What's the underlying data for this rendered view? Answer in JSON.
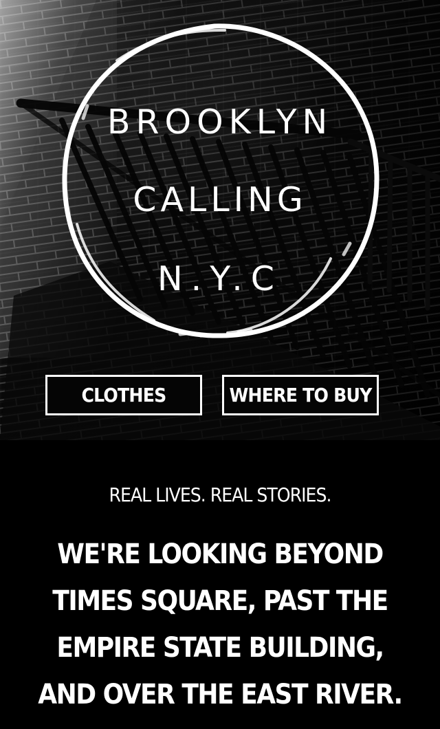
{
  "hero": {
    "logo_lines": [
      "BROOKLYN",
      "CALLING",
      "N.Y.C"
    ]
  },
  "navigation": {
    "clothes_label": "CLOTHES",
    "where_to_buy_label": "WHERE TO BUY"
  },
  "content": {
    "tagline": "REAL LIVES. REAL STORIES.",
    "statement": "WE'RE LOOKING BEYOND TIMES SQUARE, PAST THE EMPIRE STATE BUILDING, AND OVER THE EAST RIVER."
  },
  "colors": {
    "background": "#000000",
    "text": "#ffffff",
    "border": "#ffffff"
  },
  "icons": {
    "logo_circle": "hand-drawn-circle-icon",
    "hero_image": "brick-stairway-image"
  }
}
